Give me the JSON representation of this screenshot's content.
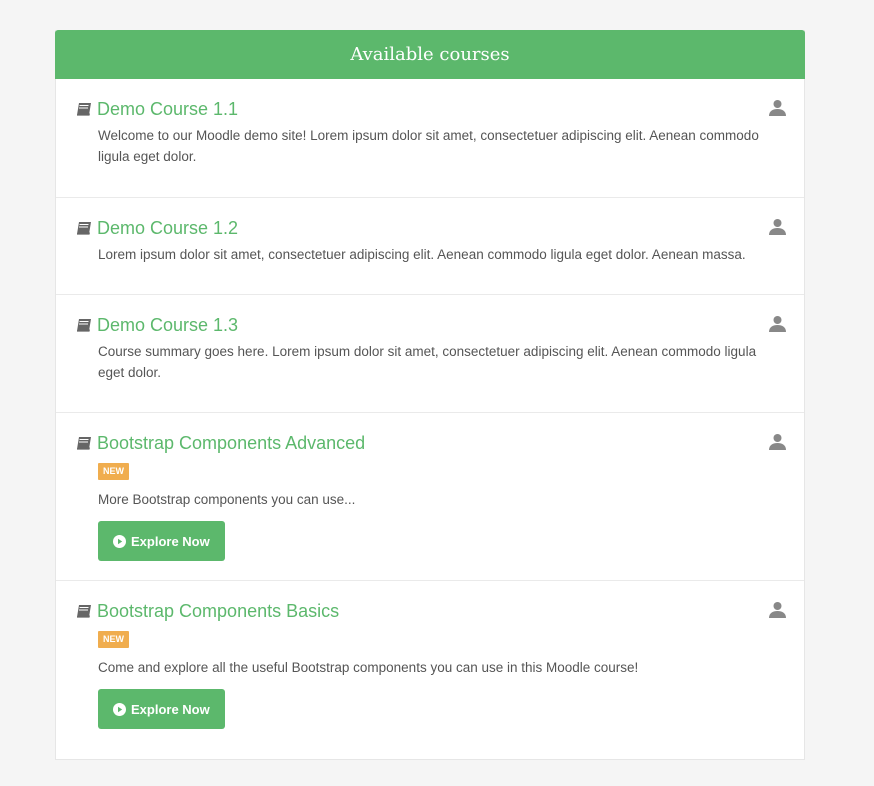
{
  "panel": {
    "title": "Available courses"
  },
  "courses": [
    {
      "name": "Demo Course 1.1",
      "badge": "",
      "summary": "Welcome to our Moodle demo site! Lorem ipsum dolor sit amet, consectetuer adipiscing elit. Aenean commodo ligula eget dolor.",
      "button": ""
    },
    {
      "name": "Demo Course 1.2",
      "badge": "",
      "summary": "Lorem ipsum dolor sit amet, consectetuer adipiscing elit. Aenean commodo ligula eget dolor. Aenean massa.",
      "button": ""
    },
    {
      "name": "Demo Course 1.3",
      "badge": "",
      "summary": "Course summary goes here. Lorem ipsum dolor sit amet, consectetuer adipiscing elit. Aenean commodo ligula eget dolor.",
      "button": ""
    },
    {
      "name": "Bootstrap Components Advanced",
      "badge": "NEW",
      "summary": "More Bootstrap components you can use...",
      "button": "Explore Now"
    },
    {
      "name": "Bootstrap Components Basics",
      "badge": "NEW",
      "summary": "Come and explore all the useful Bootstrap components you can use in this Moodle course!",
      "button": "Explore Now"
    }
  ],
  "icons": {
    "course": "book-icon",
    "enrol": "user-icon",
    "button": "play-circle-icon"
  },
  "colors": {
    "accent": "#5cb86c",
    "badge": "#f0ad4e"
  }
}
